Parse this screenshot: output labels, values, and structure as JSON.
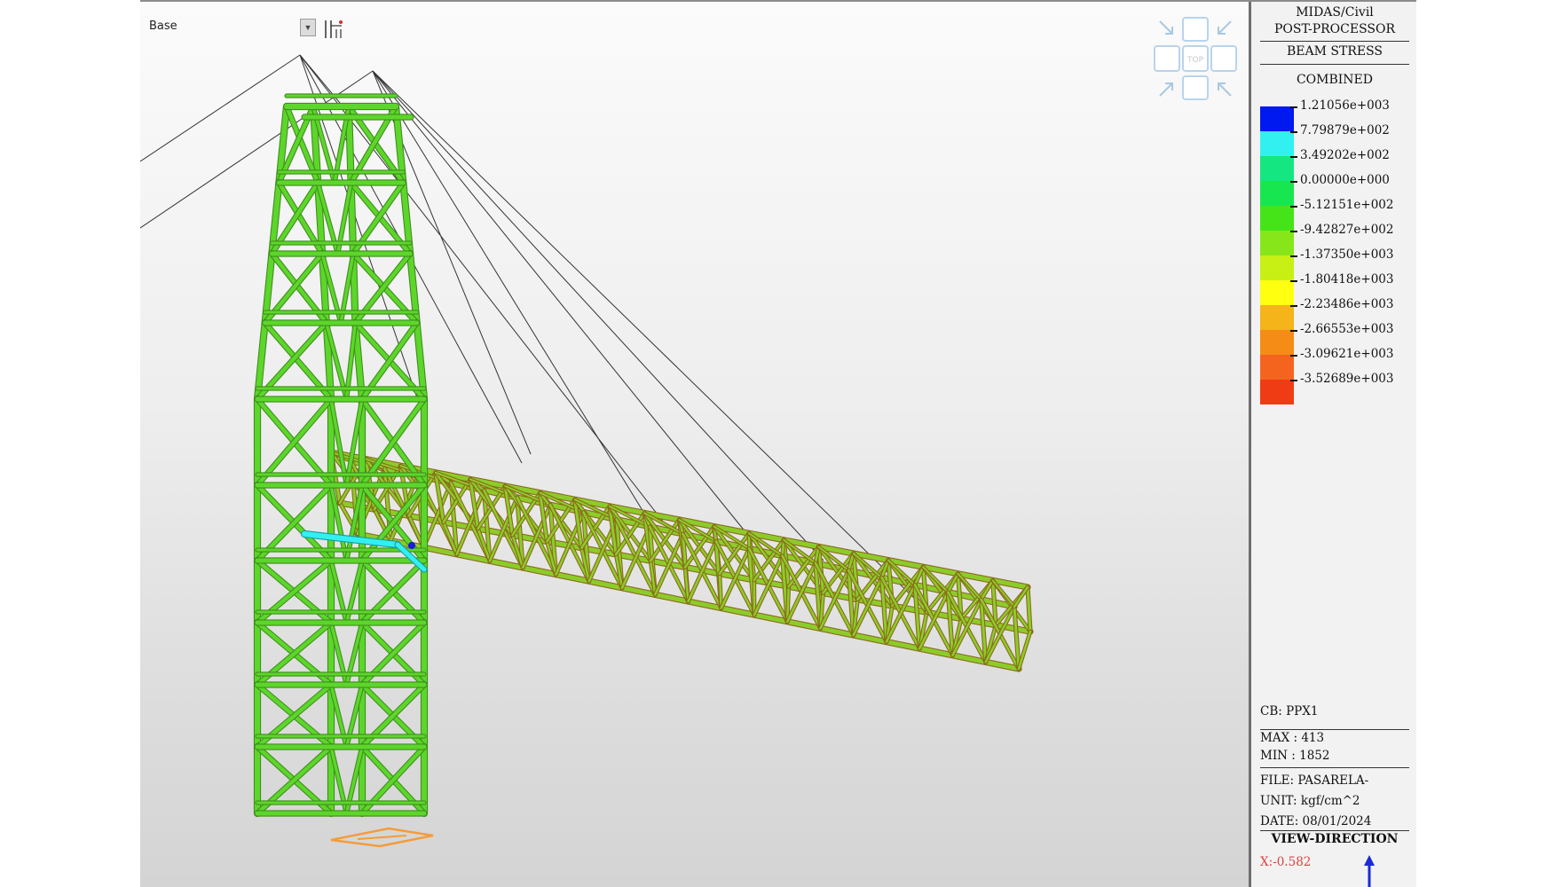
{
  "toolbar": {
    "base_label": "Base"
  },
  "view_cube": {
    "top_label": "TOP"
  },
  "legend": {
    "title_line1": "MIDAS/Civil",
    "title_line2": "POST-PROCESSOR",
    "result_type": "BEAM STRESS",
    "component": "COMBINED",
    "levels": [
      {
        "value": "1.21056e+003",
        "color": "#0019f0"
      },
      {
        "value": "7.79879e+002",
        "color": "#32f0f0"
      },
      {
        "value": "3.49202e+002",
        "color": "#14e682"
      },
      {
        "value": "0.00000e+000",
        "color": "#18e650"
      },
      {
        "value": "-5.12151e+002",
        "color": "#44e418"
      },
      {
        "value": "-9.42827e+002",
        "color": "#86e61a"
      },
      {
        "value": "-1.37350e+003",
        "color": "#c8f014"
      },
      {
        "value": "-1.80418e+003",
        "color": "#ffff10"
      },
      {
        "value": "-2.23486e+003",
        "color": "#f4b41a"
      },
      {
        "value": "-2.66553e+003",
        "color": "#f58c16"
      },
      {
        "value": "-3.09621e+003",
        "color": "#f5641e"
      },
      {
        "value": "-3.52689e+003",
        "color": "#f03c14"
      }
    ],
    "cb": "CB: PPX1",
    "max": "MAX : 413",
    "min": "MIN : 1852",
    "file": "FILE: PASARELA-",
    "unit": "UNIT: kgf/cm^2",
    "date": "DATE: 08/01/2024",
    "view_direction": "VIEW-DIRECTION",
    "x_direction": "X:-0.582"
  },
  "colors": {
    "member": "#5cd62a",
    "member_edge": "#3f8f1c",
    "deck": "#8ccc2a",
    "deck_edge": "#8a6a1a",
    "cable": "#333333",
    "support": "#f39c3c"
  }
}
